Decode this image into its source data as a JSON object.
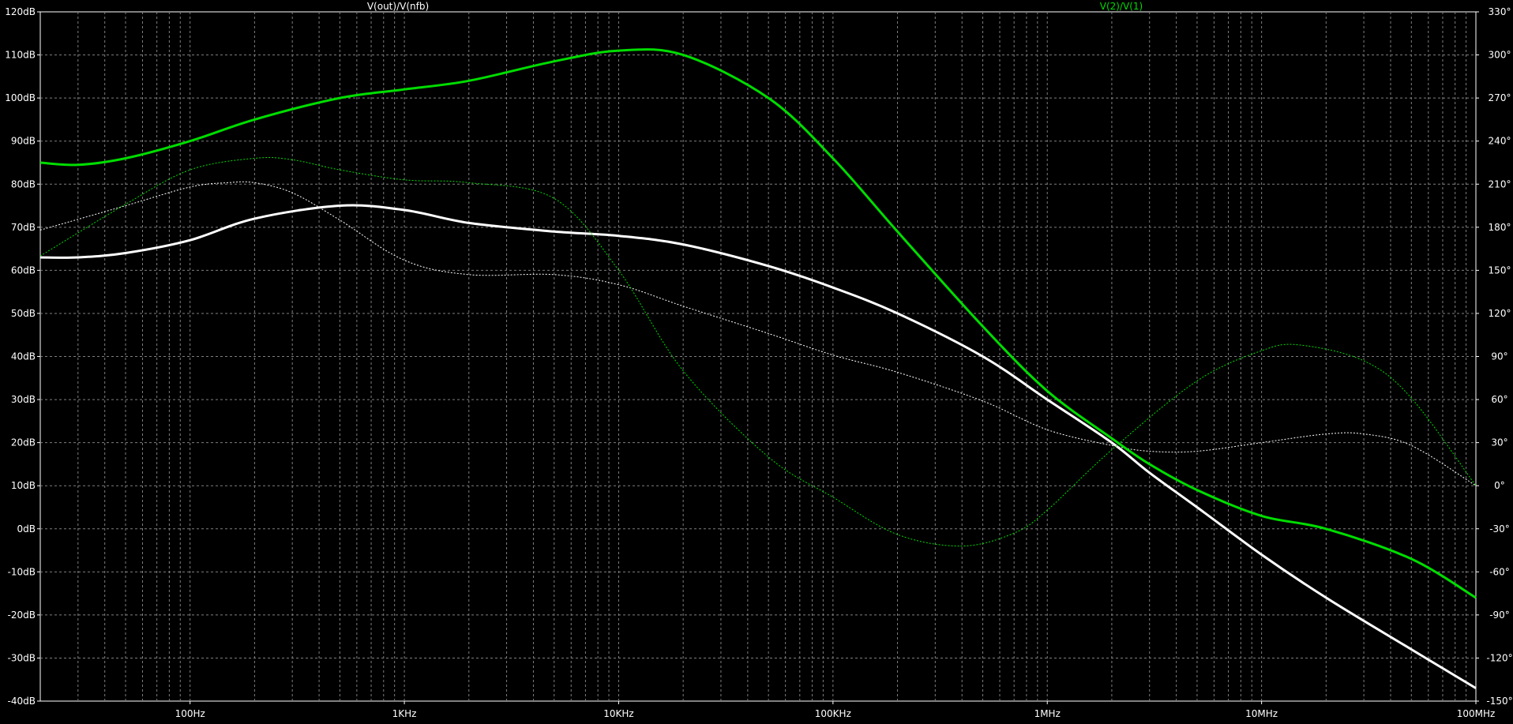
{
  "chart_data": {
    "type": "line",
    "background": "#000000",
    "grid": true,
    "grid_color": "#7f7f7f",
    "axis_color": "#ffffff",
    "x_axis": {
      "scale": "log",
      "range_hz": [
        20,
        100000000
      ],
      "tick_values_hz": [
        100,
        1000,
        10000,
        100000,
        1000000,
        10000000,
        100000000
      ],
      "tick_labels": [
        "100Hz",
        "1KHz",
        "10KHz",
        "100KHz",
        "1MHz",
        "10MHz",
        "100MHz"
      ]
    },
    "y_left": {
      "unit": "dB",
      "range": [
        -40,
        120
      ],
      "tick_values": [
        120,
        110,
        100,
        90,
        80,
        70,
        60,
        50,
        40,
        30,
        20,
        10,
        0,
        -10,
        -20,
        -30,
        -40
      ],
      "tick_labels": [
        "120dB",
        "110dB",
        "100dB",
        "90dB",
        "80dB",
        "70dB",
        "60dB",
        "50dB",
        "40dB",
        "30dB",
        "20dB",
        "10dB",
        "0dB",
        "-10dB",
        "-20dB",
        "-30dB",
        "-40dB"
      ]
    },
    "y_right": {
      "unit": "°",
      "range": [
        -150,
        330
      ],
      "tick_values": [
        330,
        300,
        270,
        240,
        210,
        180,
        150,
        120,
        90,
        60,
        30,
        0,
        -30,
        -60,
        -90,
        -120,
        -150
      ],
      "tick_labels": [
        "330°",
        "300°",
        "270°",
        "240°",
        "210°",
        "180°",
        "150°",
        "120°",
        "90°",
        "60°",
        "30°",
        "0°",
        "-30°",
        "-60°",
        "-90°",
        "-120°",
        "-150°"
      ]
    },
    "series": [
      {
        "name": "V(out)/V(nfb)",
        "color": "#ffffff",
        "magnitude_db": {
          "x": [
            20,
            30,
            50,
            100,
            200,
            500,
            1000,
            2000,
            5000,
            10000,
            20000,
            50000,
            100000,
            200000,
            500000,
            1000000,
            2000000,
            3000000,
            5000000,
            10000000,
            20000000,
            50000000,
            100000000
          ],
          "y": [
            63,
            63,
            64,
            67,
            72,
            75,
            74,
            71,
            69,
            68,
            66,
            61,
            56,
            50,
            40,
            30,
            20,
            13,
            5,
            -6,
            -16,
            -28,
            -37
          ]
        },
        "phase_deg": {
          "x": [
            20,
            50,
            100,
            150,
            200,
            300,
            500,
            1000,
            2000,
            5000,
            10000,
            20000,
            50000,
            100000,
            200000,
            500000,
            1000000,
            2000000,
            3000000,
            5000000,
            10000000,
            20000000,
            30000000,
            50000000,
            100000000
          ],
          "y": [
            178,
            195,
            208,
            211,
            211,
            204,
            185,
            157,
            147,
            147,
            140,
            125,
            106,
            91,
            79,
            59,
            39,
            28,
            24,
            24,
            30,
            36,
            36,
            28,
            0
          ]
        }
      },
      {
        "name": "V(2)/V(1)",
        "color": "#00dd00",
        "magnitude_db": {
          "x": [
            20,
            30,
            50,
            100,
            200,
            500,
            1000,
            2000,
            5000,
            10000,
            20000,
            50000,
            100000,
            200000,
            500000,
            1000000,
            2000000,
            3000000,
            5000000,
            10000000,
            20000000,
            50000000,
            100000000
          ],
          "y": [
            85,
            84.5,
            86,
            90,
            95,
            100,
            102,
            104,
            108.5,
            111,
            110,
            100,
            86,
            69,
            47,
            32,
            21,
            15,
            9,
            3,
            0,
            -7,
            -16
          ]
        },
        "phase_deg": {
          "x": [
            20,
            50,
            100,
            200,
            300,
            500,
            1000,
            2000,
            5000,
            10000,
            20000,
            50000,
            100000,
            200000,
            400000,
            700000,
            1000000,
            2000000,
            5000000,
            10000000,
            15000000,
            30000000,
            50000000,
            100000000
          ],
          "y": [
            160,
            196,
            220,
            228,
            227,
            220,
            213,
            211,
            200,
            150,
            80,
            20,
            -8,
            -34,
            -42,
            -33,
            -17,
            25,
            73,
            94,
            98,
            87,
            61,
            0
          ]
        }
      }
    ]
  }
}
